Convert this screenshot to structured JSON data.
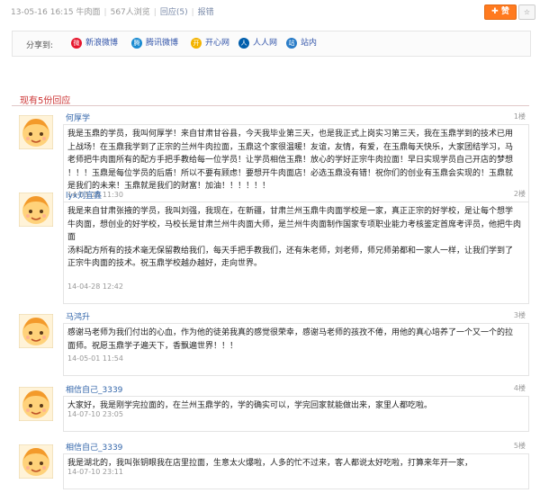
{
  "topbar": {
    "date": "13-05-16 16:15",
    "source": "牛肉面",
    "views": "567人浏览",
    "replies": "回应(5)",
    "report": "报错",
    "like_label": "赞",
    "fav_icon": "star-icon"
  },
  "share": {
    "label": "分享到:",
    "items": [
      {
        "label": "新浪微博",
        "icon": "weibo-icon",
        "color": "#e6162d"
      },
      {
        "label": "腾讯微博",
        "icon": "tencent-weibo-icon",
        "color": "#1a8bd1"
      },
      {
        "label": "开心网",
        "icon": "kaixin-icon",
        "color": "#f3b300"
      },
      {
        "label": "人人网",
        "icon": "renren-icon",
        "color": "#005eac"
      },
      {
        "label": "站内",
        "icon": "site-icon",
        "color": "#2a7cc7"
      }
    ]
  },
  "replies_title": "现有5份回应",
  "replies": [
    {
      "username": "何厚学",
      "floor": "1楼",
      "lines": [
        "我是玉鼎的学员，我叫何厚学！来自甘肃甘谷县，今天我毕业第三天，也是我正式上岗实习第三天，我在玉鼎学到的技术已用",
        "上战场！在玉鼎我学到了正宗的兰州牛肉拉面，玉鼎这个家很温暖！友谊，友情，有爱，在玉鼎每天快乐，大家团结学习，马",
        "老师把牛肉面所有的配方手把手教给每一位学员！让学员相信玉鼎！放心的学好正宗牛肉拉面！早日实现学员自己开店的梦想",
        "！！！玉鼎是每位学员的后盾！所以不要有顾虑！要想开牛肉面店！必选玉鼎没有错！祝你们的创业有玉鼎会实现的！玉鼎就",
        "是我们的未来！玉鼎就是我们的财富！加油！！！！！！"
      ],
      "time": "14-03-29 11:30"
    },
    {
      "username": "lyx刘宜鑫",
      "floor": "2楼",
      "lines": [
        "我是来自甘肃张掖的学员，我叫刘强，我现在，在新疆，甘肃兰州玉鼎牛肉面学校是一家，真正正宗的好学校，是让每个想学",
        "牛肉面，想创业的好学校，马校长是甘肃兰州牛肉面大师，是兰州牛肉面制作国家专项职业能力考核鉴定首席考评员，他把牛肉面",
        "汤料配方所有的技术毫无保留教给我们，每天手把手教我们，还有朱老师，刘老师，师兄师弟都和一家人一样，让我们学到了",
        "正宗牛肉面的技术。祝玉鼎学校越办越好，走向世界。"
      ],
      "time": "14-04-28 12:42"
    },
    {
      "username": "马鸿升",
      "floor": "3楼",
      "lines": [
        "感谢马老师为我们付出的心血，作为他的徒弟我真的感觉很荣幸，感谢马老师的孩孜不倦，用他的真心培养了一个又一个的拉",
        "面师。祝愿玉鼎学子遍天下，香飘遍世界！！！"
      ],
      "time": "14-05-01 11:54"
    },
    {
      "username": "相信自己_3339",
      "floor": "4楼",
      "lines": [
        "大家好，我是刚学完拉面的，在兰州玉鼎学的，学的确实可以，学完回家就能做出来，家里人都吃啦。"
      ],
      "time": "14-07-10 23:05"
    },
    {
      "username": "相信自己_3339",
      "floor": "5楼",
      "lines": [
        "我是湖北的，我叫张钥眼我在店里拉面，生意太火爆啦，人多的忙不过来，客人都说太好吃啦，打算来年开一家，"
      ],
      "time": "14-07-10 23:11"
    }
  ]
}
